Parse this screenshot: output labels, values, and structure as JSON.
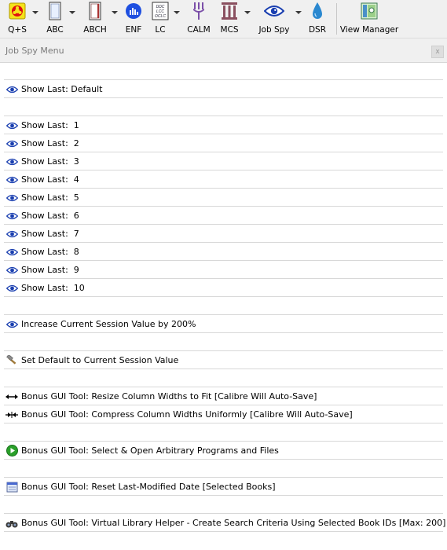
{
  "toolbar": {
    "buttons": [
      {
        "label": "Q+S",
        "icon": "biohazard-icon"
      },
      {
        "label": "ABC",
        "icon": "book-icon"
      },
      {
        "label": "ABCH",
        "icon": "book-icon"
      },
      {
        "label": "ENF",
        "icon": "bar-chart-icon"
      },
      {
        "label": "LC",
        "icon": "catalog-card-icon"
      },
      {
        "label": "CALM",
        "icon": "fork-icon"
      },
      {
        "label": "MCS",
        "icon": "pillar-icon"
      },
      {
        "label": "Job Spy",
        "icon": "eye-icon"
      },
      {
        "label": "DSR",
        "icon": "water-drop-icon"
      },
      {
        "label": "View Manager",
        "icon": "view-manager-icon"
      }
    ],
    "colors": {
      "eye": "#1a3fb0",
      "biohazard": "#e01010",
      "enf": "#1e4fe0",
      "drop": "#2a88d0",
      "fork": "#7b4fa8"
    }
  },
  "panel": {
    "title": "Job Spy Menu",
    "close_label": "x"
  },
  "menu": {
    "items": [
      {
        "label": "Show Last: Default",
        "icon": "eye-icon"
      },
      {
        "label": "Show Last:  1",
        "icon": "eye-icon"
      },
      {
        "label": "Show Last:  2",
        "icon": "eye-icon"
      },
      {
        "label": "Show Last:  3",
        "icon": "eye-icon"
      },
      {
        "label": "Show Last:  4",
        "icon": "eye-icon"
      },
      {
        "label": "Show Last:  5",
        "icon": "eye-icon"
      },
      {
        "label": "Show Last:  6",
        "icon": "eye-icon"
      },
      {
        "label": "Show Last:  7",
        "icon": "eye-icon"
      },
      {
        "label": "Show Last:  8",
        "icon": "eye-icon"
      },
      {
        "label": "Show Last:  9",
        "icon": "eye-icon"
      },
      {
        "label": "Show Last:  10",
        "icon": "eye-icon"
      },
      {
        "label": "Increase Current Session Value by 200%",
        "icon": "eye-icon"
      },
      {
        "label": "Set Default to Current Session Value",
        "icon": "hammer-icon"
      },
      {
        "label": "Bonus GUI Tool: Resize Column Widths to Fit [Calibre Will Auto-Save]",
        "icon": "resize-arrows-icon"
      },
      {
        "label": "Bonus GUI Tool: Compress Column Widths Uniformly [Calibre Will Auto-Save]",
        "icon": "compress-arrows-icon"
      },
      {
        "label": "Bonus GUI Tool: Select & Open Arbitrary Programs and Files",
        "icon": "play-icon"
      },
      {
        "label": "Bonus GUI Tool: Reset Last-Modified Date [Selected Books]",
        "icon": "calendar-icon"
      },
      {
        "label": "Bonus GUI Tool: Virtual Library Helper - Create Search Criteria Using Selected Book IDs [Max: 200]",
        "icon": "binoculars-icon"
      }
    ]
  }
}
